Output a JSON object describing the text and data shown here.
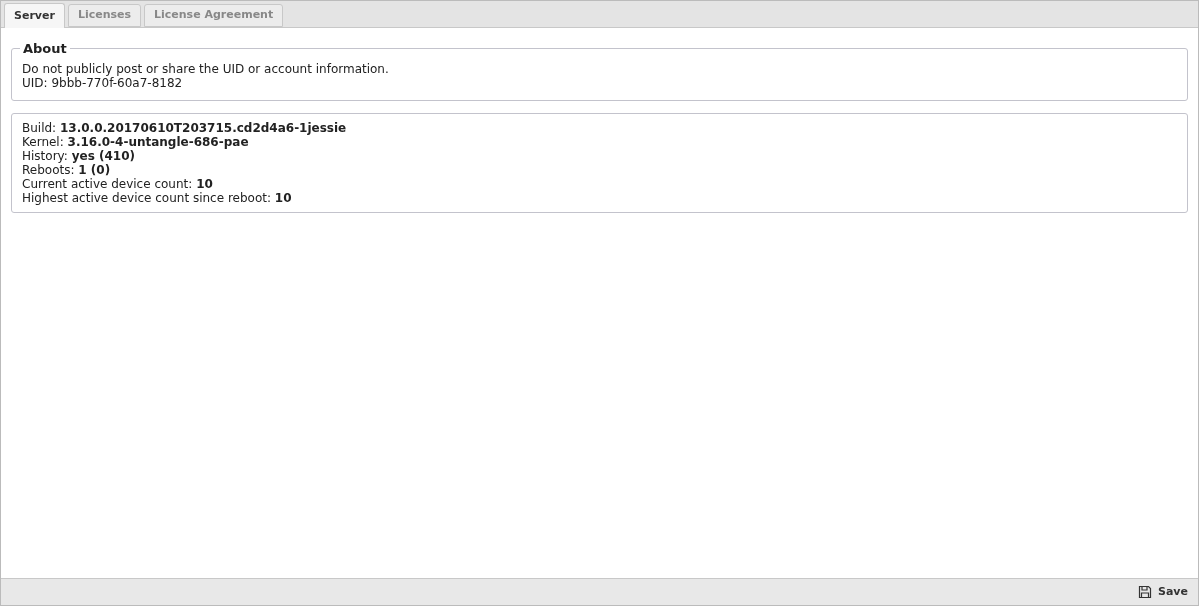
{
  "tabs": [
    {
      "label": "Server",
      "selected": true
    },
    {
      "label": "Licenses",
      "selected": false
    },
    {
      "label": "License Agreement",
      "selected": false
    }
  ],
  "about": {
    "title": "About",
    "lines": [
      "Do not publicly post or share the UID or account information.",
      "UID: 9bbb-770f-60a7-8182"
    ]
  },
  "info": {
    "lines": [
      "Build: **13.0.0.20170610T203715.cd2d4a6-1jessie**",
      "Kernel: **3.16.0-4-untangle-686-pae**",
      "History: **yes (410)**",
      "Reboots: **1 (0)**",
      "Current active device count: **10**",
      "Highest active device count since reboot: **10**"
    ]
  },
  "footer": {
    "save_label": "Save"
  }
}
